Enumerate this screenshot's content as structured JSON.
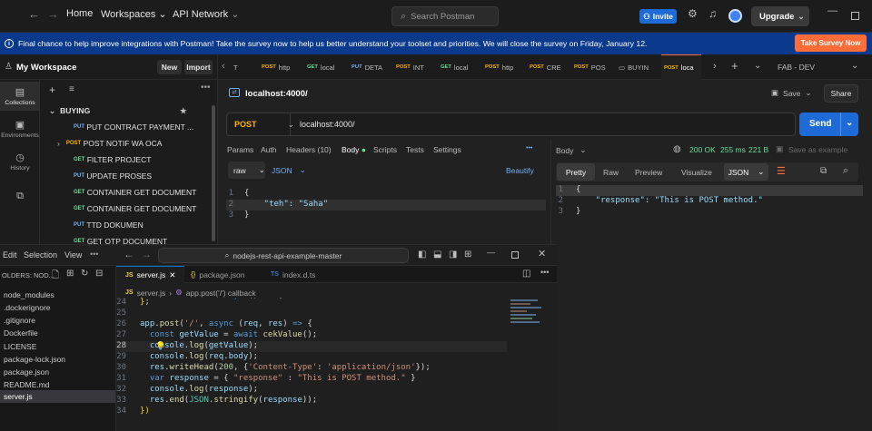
{
  "topbar": {
    "nav_home": "Home",
    "nav_workspaces": "Workspaces",
    "nav_api_network": "API Network",
    "search_placeholder": "Search Postman",
    "invite": "Invite",
    "upgrade": "Upgrade"
  },
  "banner": {
    "text": "Final chance to help improve integrations with Postman! Take the survey now to help us better understand your toolset and priorities. We will close the survey on Friday, January 12.",
    "button": "Take Survey Now"
  },
  "workspace": {
    "name": "My Workspace",
    "new": "New",
    "import": "Import"
  },
  "rail": {
    "collections": "Collections",
    "environments": "Environments",
    "history": "History"
  },
  "tree": {
    "folder": "BUYING",
    "items": [
      {
        "method": "PUT",
        "name": "PUT CONTRACT PAYMENT ..."
      },
      {
        "method": "POST",
        "name": "POST NOTIF WA OCA"
      },
      {
        "method": "GET",
        "name": "FILTER PROJECT"
      },
      {
        "method": "PUT",
        "name": "UPDATE PROSES"
      },
      {
        "method": "GET",
        "name": "CONTAINER GET DOCUMENT"
      },
      {
        "method": "GET",
        "name": "CONTAINER GET DOCUMENT"
      },
      {
        "method": "PUT",
        "name": "TTD DOKUMEN"
      },
      {
        "method": "GET",
        "name": "GET OTP DOCUMENT"
      }
    ]
  },
  "tabs": [
    {
      "method": "",
      "name": "T"
    },
    {
      "method": "POST",
      "name": "http"
    },
    {
      "method": "GET",
      "name": "local"
    },
    {
      "method": "PUT",
      "name": "DETA"
    },
    {
      "method": "POST",
      "name": "INT"
    },
    {
      "method": "GET",
      "name": "local"
    },
    {
      "method": "POST",
      "name": "http"
    },
    {
      "method": "POST",
      "name": "CRE"
    },
    {
      "method": "POST",
      "name": "POS"
    },
    {
      "method": "",
      "name": "BUYIN"
    },
    {
      "method": "POST",
      "name": "loca"
    }
  ],
  "environment": "FAB - DEV",
  "request": {
    "title": "localhost:4000/",
    "save": "Save",
    "share": "Share",
    "method": "POST",
    "url": "localhost:4000/",
    "send": "Send",
    "subtabs": {
      "params": "Params",
      "auth": "Auth",
      "headers": "Headers (10)",
      "body": "Body",
      "scripts": "Scripts",
      "tests": "Tests",
      "settings": "Settings"
    },
    "body_type": "raw",
    "body_format": "JSON",
    "beautify": "Beautify",
    "body_lines": [
      "{",
      "    \"teh\": \"Saha\"",
      "}"
    ]
  },
  "response": {
    "label": "Body",
    "status": "200 OK",
    "time": "255 ms",
    "size": "221 B",
    "save_example": "Save as example",
    "views": {
      "pretty": "Pretty",
      "raw": "Raw",
      "preview": "Preview",
      "visualize": "Visualize"
    },
    "format": "JSON",
    "lines": [
      "{",
      "    \"response\": \"This is POST method.\"",
      "}"
    ]
  },
  "vscode": {
    "menu_edit": "Edit",
    "menu_selection": "Selection",
    "menu_view": "View",
    "search_title": "nodejs-rest-api-example-master",
    "explorer_title": "OLDERS: NOD...",
    "files": [
      "node_modules",
      ".dockerignore",
      ".gitignore",
      "Dockerfile",
      "LICENSE",
      "package-lock.json",
      "package.json",
      "README.md",
      "server.js"
    ],
    "editor_tabs": [
      "server.js",
      "package.json",
      "index.d.ts"
    ],
    "breadcrumb_file": "server.js",
    "breadcrumb_symbol": "app.post('/') callback",
    "line_numbers": [
      "24",
      "25",
      "26",
      "27",
      "28",
      "29",
      "30",
      "31",
      "32",
      "33",
      "34"
    ]
  },
  "colors": {
    "accent": "#ff6c37",
    "primary_blue": "#1e6ad6",
    "status_ok": "#6bdd9a"
  }
}
